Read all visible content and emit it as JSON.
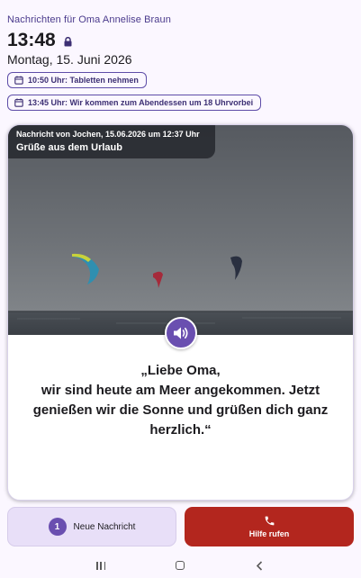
{
  "header": {
    "title": "Nachrichten für Oma Annelise Braun",
    "time": "13:48",
    "date": "Montag, 15. Juni 2026",
    "lock_icon": "lock-icon"
  },
  "reminders": [
    {
      "icon": "calendar-icon",
      "text": "10:50 Uhr: Tabletten nehmen"
    },
    {
      "icon": "calendar-icon",
      "text": "13:45 Uhr: Wir kommen zum Abendessen um 18 Uhrvorbei"
    }
  ],
  "message_card": {
    "sender_line": "Nachricht von Jochen, 15.06.2026 um 12:37 Uhr",
    "subject": "Grüße aus dem Urlaub",
    "image_subject": "kitesurfers over the sea",
    "speaker_icon": "volume-icon",
    "text_lines": [
      "„Liebe Oma,",
      "wir sind heute am Meer angekommen. Jetzt",
      "genießen wir die Sonne und grüßen dich ganz",
      "herzlich.“"
    ]
  },
  "actions": {
    "new_message_count": "1",
    "new_message_label": "Neue Nachricht",
    "help_label": "Hilfe rufen",
    "help_icon": "phone-icon"
  },
  "colors": {
    "accent": "#6A4FB0",
    "help_button": "#B3261E",
    "new_message_button": "#E8DFF8",
    "background": "#FBF7FF"
  },
  "navigation": [
    "recents-icon",
    "home-icon",
    "back-icon"
  ]
}
